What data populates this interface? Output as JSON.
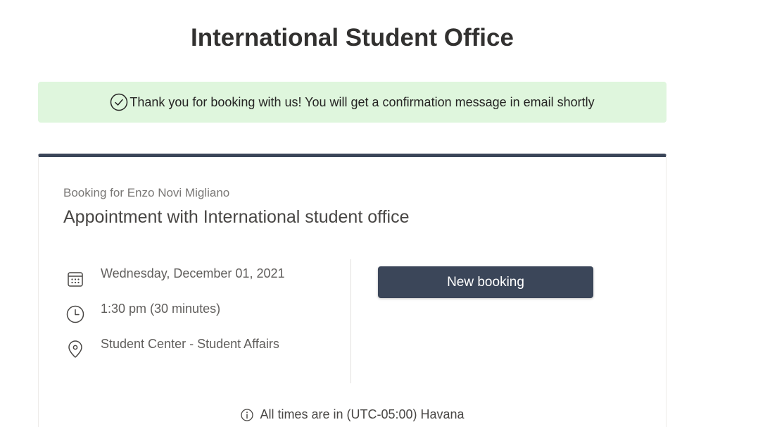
{
  "page": {
    "title": "International Student Office"
  },
  "banner": {
    "icon": "check-circle-icon",
    "message": "Thank you for booking with us! You will get a confirmation message in email shortly",
    "color": "#dff6dd"
  },
  "booking": {
    "booking_for": "Booking for Enzo Novi Migliano",
    "service_title": "Appointment with International student office",
    "details": [
      {
        "icon": "calendar-icon",
        "text": "Wednesday, December 01, 2021"
      },
      {
        "icon": "clock-icon",
        "text": "1:30 pm (30 minutes)"
      },
      {
        "icon": "location-pin-icon",
        "text": "Student Center - Student Affairs"
      }
    ],
    "new_booking_label": "New booking",
    "accent_color": "#3b4659"
  },
  "footer": {
    "icon": "info-icon",
    "timezone_text": "All times are in (UTC-05:00) Havana"
  }
}
